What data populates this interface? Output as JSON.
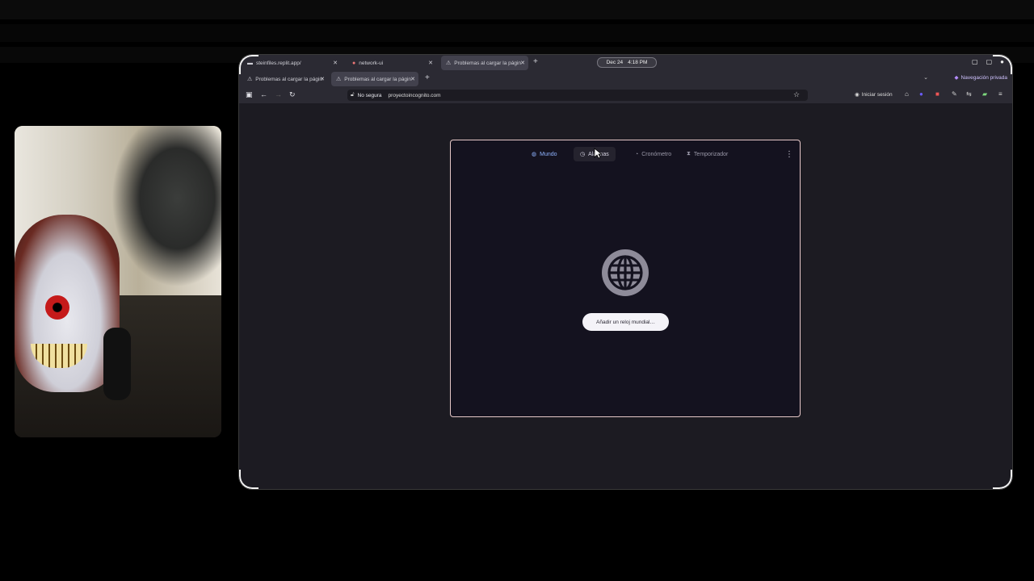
{
  "browser": {
    "tabs_row1": [
      {
        "label": "steinfiles.replit.app/",
        "active": false
      },
      {
        "label": "network-ui",
        "active": false
      },
      {
        "label": "Problemas al cargar la págin",
        "active": true
      }
    ],
    "tabs_row2": [
      {
        "label": "Problemas al cargar la págin",
        "active": false
      },
      {
        "label": "Problemas al cargar la págin",
        "active": true
      }
    ],
    "clock": {
      "date": "Dec 24",
      "time": "4:18 PM"
    },
    "private_label": "Navegación privada",
    "url": {
      "security_label": "No segura",
      "address": "proyectoincognito.com"
    },
    "signin_label": "Iniciar sesión",
    "new_tab_symbol": "+"
  },
  "clock_app": {
    "tabs": [
      {
        "label": "Mundo",
        "icon": "globe-icon",
        "state": "selected"
      },
      {
        "label": "Alarmas",
        "icon": "alarm-icon",
        "state": "hover"
      },
      {
        "label": "Cronómetro",
        "icon": "stopwatch-icon",
        "state": "normal"
      },
      {
        "label": "Temporizador",
        "icon": "hourglass-icon",
        "state": "normal"
      }
    ],
    "add_button_label": "Añadir un reloj mundial…",
    "accent_color": "#8fb3ff"
  }
}
